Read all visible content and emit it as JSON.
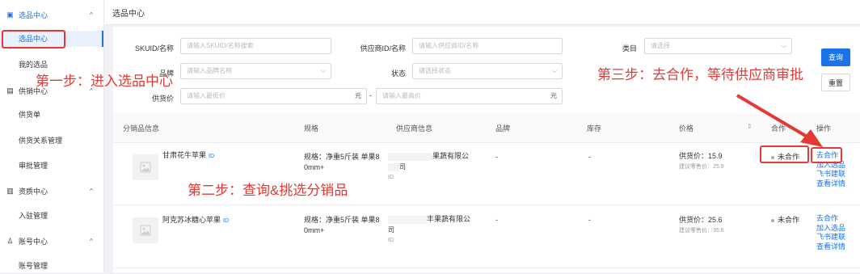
{
  "sidebar": {
    "groups": [
      {
        "label": "选品中心",
        "icon": "catalog-icon",
        "chevron": "^"
      },
      {
        "label": "供销中心",
        "icon": "supply-icon",
        "chevron": "^"
      },
      {
        "label": "资质中心",
        "icon": "license-icon",
        "chevron": "^"
      },
      {
        "label": "账号中心",
        "icon": "user-icon",
        "chevron": "^"
      }
    ],
    "items": [
      {
        "label": "选品中心"
      },
      {
        "label": "我的选品"
      },
      {
        "label": "供货单"
      },
      {
        "label": "供货关系管理"
      },
      {
        "label": "审批管理"
      },
      {
        "label": "入驻管理"
      },
      {
        "label": "账号管理"
      }
    ]
  },
  "page": {
    "title": "选品中心"
  },
  "filters": {
    "skuid": {
      "label": "SKUID/名称",
      "placeholder": "请输入SKUID/名称搜索"
    },
    "supplier": {
      "label": "供应商ID/名称",
      "placeholder": "请输入供应商ID/名称"
    },
    "category": {
      "label": "类目",
      "placeholder": "请选择"
    },
    "brand": {
      "label": "品牌",
      "placeholder": "请输入品牌名称"
    },
    "status": {
      "label": "状态",
      "placeholder": "请选择状态"
    },
    "price": {
      "label": "供货价",
      "min_placeholder": "请输入最低价",
      "max_placeholder": "请输入最高价",
      "unit": "元",
      "separator": "-"
    },
    "query_button": "查询",
    "reset_button": "重置"
  },
  "table": {
    "headers": [
      "分销品信息",
      "规格",
      "供应商信息",
      "品牌",
      "库存",
      "价格",
      "合作",
      "操作"
    ],
    "sort_icon": "sort-icon",
    "rows": [
      {
        "name": "甘肃花牛苹果",
        "id_tag": "ID",
        "spec_line1": "规格：净重5斤装 单果8",
        "spec_line2": "0mm+",
        "supplier_line1": "果蔬有限公",
        "supplier_line2": "司",
        "supplier_id": "ID",
        "brand": "-",
        "stock": "-",
        "price": "供货价：15.9",
        "suggested": "建议零售价：25.9",
        "status": "未合作",
        "actions": [
          "去合作",
          "加入选品",
          "飞书建联",
          "查看详情"
        ]
      },
      {
        "name": "阿克苏冰糖心苹果",
        "id_tag": "ID",
        "spec_line1": "规格：净重5斤装 单果8",
        "spec_line2": "0mm+",
        "supplier_line1": "丰果蔬有限公",
        "supplier_line2": "司",
        "supplier_id": "ID",
        "brand": "-",
        "stock": "-",
        "price": "供货价：25.6",
        "suggested": "建议零售价：35.6",
        "status": "未合作",
        "actions": [
          "去合作",
          "加入选品",
          "飞书建联",
          "查看详情"
        ]
      }
    ]
  },
  "annotations": {
    "step1": "第一步：进入选品中心",
    "step2": "第二步：查询&挑选分销品",
    "step3": "第三步：去合作，等待供应商审批"
  },
  "colors": {
    "accent": "#1a73e8",
    "annotation": "#e53935"
  }
}
